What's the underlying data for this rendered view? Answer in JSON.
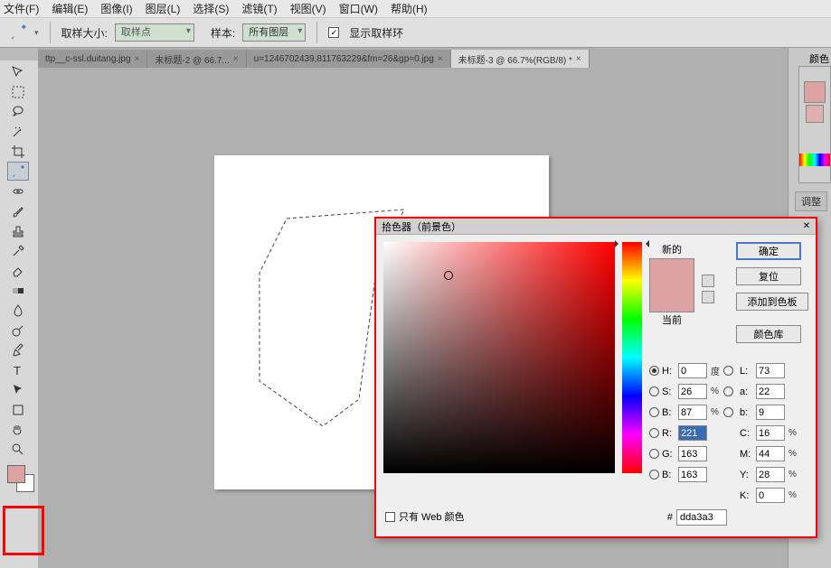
{
  "menu": {
    "file": "文件(F)",
    "edit": "编辑(E)",
    "image": "图像(I)",
    "layer": "图层(L)",
    "select": "选择(S)",
    "filter": "滤镜(T)",
    "view": "视图(V)",
    "window": "窗口(W)",
    "help": "帮助(H)"
  },
  "optbar": {
    "sampleSize": "取样大小:",
    "sampleSizeVal": "取样点",
    "sample": "样本:",
    "sampleVal": "所有图层",
    "showRing": "显示取样环"
  },
  "tabs": [
    {
      "label": "ttp__c-ssl.duitang.jpg",
      "close": "×"
    },
    {
      "label": "未标题-2 @ 66.7...",
      "close": "×"
    },
    {
      "label": "u=1246702439,811763229&fm=26&gp=0.jpg",
      "close": "×"
    },
    {
      "label": "未标题-3 @ 66.7%(RGB/8) *",
      "close": "×",
      "active": true
    }
  ],
  "picker": {
    "title": "拾色器（前景色）",
    "new": "新的",
    "current": "当前",
    "ok": "确定",
    "reset": "复位",
    "addSwatch": "添加到色板",
    "colorLib": "颜色库",
    "H": "H:",
    "Hval": "0",
    "Hdeg": "度",
    "S": "S:",
    "Sval": "26",
    "B": "B:",
    "Bval": "87",
    "L": "L:",
    "Lval": "73",
    "a": "a:",
    "aval": "22",
    "b": "b:",
    "bval": "9",
    "R": "R:",
    "Rval": "221",
    "G": "G:",
    "Gval": "163",
    "Bb": "B:",
    "Bbval": "163",
    "C": "C:",
    "Cval": "16",
    "M": "M:",
    "Mval": "44",
    "Y": "Y:",
    "Yval": "28",
    "K": "K:",
    "Kval": "0",
    "pct": "%",
    "hash": "#",
    "hex": "dda3a3",
    "webOnly": "只有 Web 颜色"
  },
  "rp": {
    "color": "颜色",
    "adjust": "调整"
  }
}
